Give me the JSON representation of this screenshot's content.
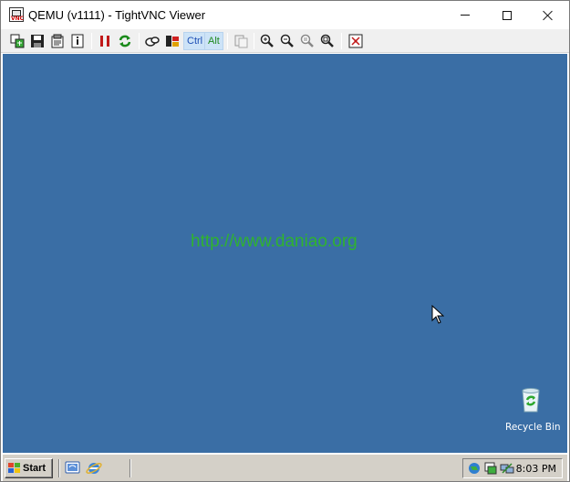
{
  "window": {
    "title": "QEMU (v1111) - TightVNC Viewer",
    "icons": {
      "app": "vnc-app-icon",
      "minimize": "minimize-icon",
      "maximize": "maximize-icon",
      "close": "close-icon"
    }
  },
  "toolbar": {
    "ctrl_label": "Ctrl",
    "alt_label": "Alt",
    "icons": [
      "new-connection-icon",
      "save-icon",
      "options-icon",
      "info-icon",
      "pause-icon",
      "refresh-icon",
      "ctrl-alt-del-icon",
      "ctrl-esc-icon",
      "ctrl-key",
      "alt-key",
      "clipboard-icon",
      "zoom-in-icon",
      "zoom-out-icon",
      "zoom-100-icon",
      "zoom-auto-icon",
      "fullscreen-icon"
    ]
  },
  "desktop": {
    "background_color": "#3a6ea5",
    "watermark": "http://www.daniao.org",
    "recycle_bin_label": "Recycle Bin"
  },
  "taskbar": {
    "start_label": "Start",
    "clock": "8:03 PM",
    "quick_launch": [
      "show-desktop-icon",
      "internet-explorer-icon"
    ],
    "tray": [
      "network-icon",
      "tray-app-icon",
      "tray-network-icon"
    ]
  }
}
